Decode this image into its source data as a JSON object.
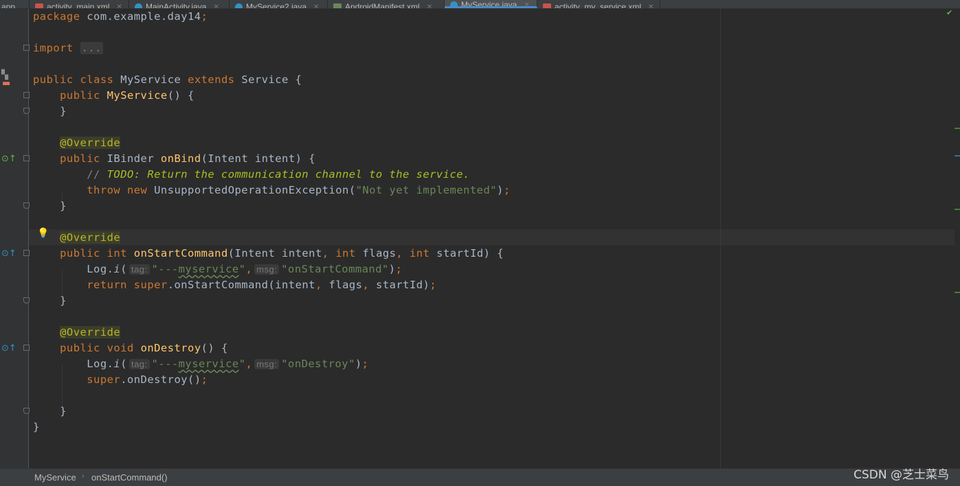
{
  "tabs": [
    {
      "label": "app",
      "icon": "folder",
      "active": false
    },
    {
      "label": "activity_main.xml",
      "icon": "xml-file",
      "active": false
    },
    {
      "label": "MainActivity.java",
      "icon": "java-class",
      "active": false
    },
    {
      "label": "MyService2.java",
      "icon": "java-class",
      "active": false
    },
    {
      "label": "AndroidManifest.xml",
      "icon": "manifest-file",
      "active": false
    },
    {
      "label": "MyService.java",
      "icon": "java-class",
      "active": true
    },
    {
      "label": "activity_my_service.xml",
      "icon": "xml-file",
      "active": false
    }
  ],
  "code": {
    "package_kw": "package",
    "package_name": " com.example.day14",
    "semi": ";",
    "import_kw": "import",
    "import_fold": "...",
    "public": "public",
    "class": "class",
    "extends": "extends",
    "class_name": "MyService",
    "super_class": "Service",
    "ctor_name": "MyService",
    "override": "@Override",
    "ibinder": "IBinder",
    "on_bind": "onBind",
    "intent_type": "Intent",
    "intent_param": "intent",
    "comment_slashes": "// ",
    "todo_text": "TODO: Return the communication channel to the service.",
    "throw": "throw",
    "new": "new",
    "exception": "UnsupportedOperationException",
    "not_impl_str": "\"Not yet implemented\"",
    "int": "int",
    "on_start_command": "onStartCommand",
    "flags": "flags",
    "start_id": "startId",
    "log": "Log",
    "log_i": "i",
    "hint_tag": "tag:",
    "hint_msg": "msg:",
    "tag_prefix": "\"---",
    "tag_word": "myservice",
    "tag_suffix": "\"",
    "msg_start": "\"onStartCommand\"",
    "return": "return",
    "super": "super",
    "void": "void",
    "on_destroy": "onDestroy",
    "msg_destroy": "\"onDestroy\""
  },
  "breadcrumb": {
    "class": "MyService",
    "method": "onStartCommand()"
  },
  "watermark": "CSDN @芝士菜鸟",
  "colors": {
    "background": "#2b2b2b",
    "keyword": "#cc7832",
    "method": "#ffc66d",
    "string": "#6a8759",
    "annotation": "#bbb529",
    "todo": "#a8c023"
  }
}
